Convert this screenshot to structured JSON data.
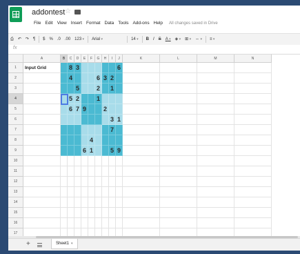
{
  "app": {
    "doc_title": "addontest",
    "menu": [
      "File",
      "Edit",
      "View",
      "Insert",
      "Format",
      "Data",
      "Tools",
      "Add-ons",
      "Help"
    ],
    "save_status": "All changes saved in Drive"
  },
  "toolbar": {
    "currency": "$",
    "percent": "%",
    "decimal_less": ".0",
    "decimal_more": ".00",
    "more_formats": "123",
    "font": "Arial",
    "font_size": "14",
    "bold": "B",
    "italic": "I",
    "strike": "S",
    "text_color": "A"
  },
  "formula_bar": {
    "fx": "fx"
  },
  "grid": {
    "columns": [
      "A",
      "B",
      "C",
      "D",
      "E",
      "F",
      "G",
      "H",
      "I",
      "J",
      "K",
      "L",
      "M",
      "N"
    ],
    "rows": [
      "1",
      "2",
      "3",
      "4",
      "5",
      "6",
      "7",
      "8",
      "9",
      "10",
      "11",
      "12",
      "13",
      "14",
      "15",
      "16",
      "17"
    ],
    "label": "Input Grid",
    "sudoku": [
      [
        "",
        "8",
        "3",
        "",
        "",
        "",
        "",
        "",
        "6"
      ],
      [
        "",
        "4",
        "",
        "",
        "",
        "6",
        "3",
        "2",
        ""
      ],
      [
        "",
        "",
        "5",
        "",
        "",
        "2",
        "",
        "1",
        ""
      ],
      [
        "",
        "5",
        "2",
        "",
        "",
        "1",
        "",
        "",
        ""
      ],
      [
        "",
        "6",
        "7",
        "9",
        "",
        "",
        "2",
        "",
        ""
      ],
      [
        "",
        "",
        "",
        "",
        "",
        "",
        "",
        "3",
        "1"
      ],
      [
        "",
        "",
        "",
        "",
        "",
        "",
        "",
        "7",
        ""
      ],
      [
        "",
        "",
        "",
        "",
        "4",
        "",
        "",
        "",
        ""
      ],
      [
        "",
        "",
        "",
        "6",
        "1",
        "",
        "",
        "5",
        "9"
      ]
    ],
    "selected_cell": "B4"
  },
  "colors": {
    "block_dark": "#4bbad2",
    "block_light": "#a8dcea",
    "selection": "#4d7be3"
  },
  "bottom": {
    "add_sheet": "+",
    "sheet_tab": "Sheet1"
  }
}
